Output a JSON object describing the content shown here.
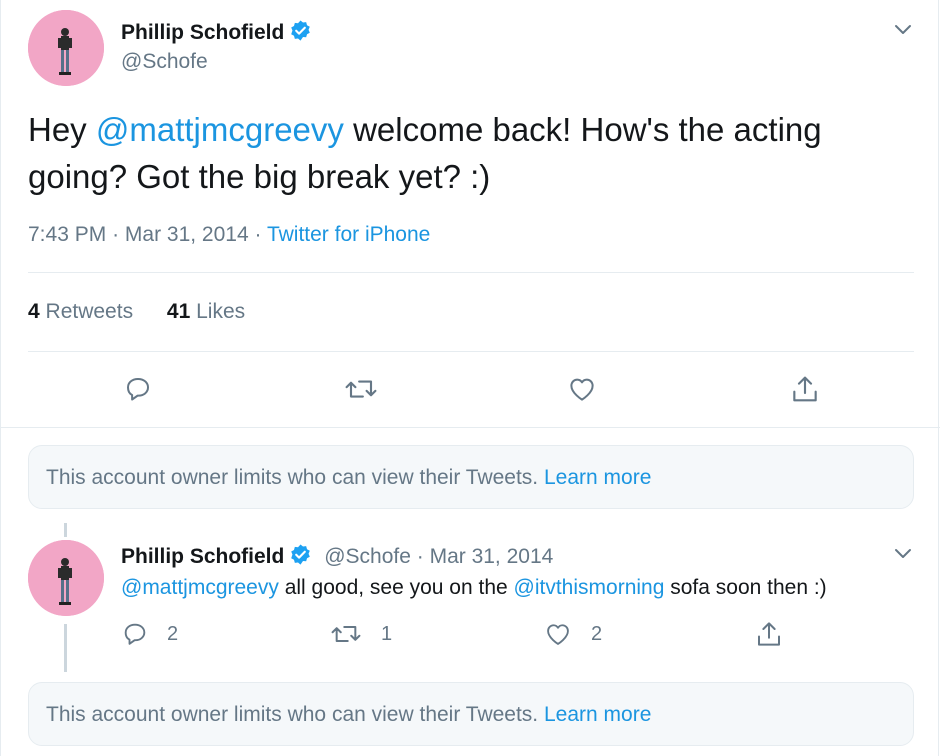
{
  "main_tweet": {
    "author_name": "Phillip Schofield",
    "handle": "@Schofe",
    "text_prefix": "Hey ",
    "mention": "@mattjmcgreevy",
    "text_suffix": " welcome back! How's the acting going? Got the big break yet? :)",
    "time": "7:43 PM",
    "date": "Mar 31, 2014",
    "source": "Twitter for iPhone",
    "retweets_count": "4",
    "retweets_label": "Retweets",
    "likes_count": "41",
    "likes_label": "Likes"
  },
  "notices": [
    {
      "text": "This account owner limits who can view their Tweets.",
      "link": "Learn more"
    },
    {
      "text": "This account owner limits who can view their Tweets.",
      "link": "Learn more"
    }
  ],
  "reply": {
    "author_name": "Phillip Schofield",
    "handle": "@Schofe",
    "date": "Mar 31, 2014",
    "mention1": "@mattjmcgreevy",
    "text_mid": " all good, see you on the ",
    "mention2": "@itvthismorning",
    "text_end": " sofa soon then :)",
    "reply_count": "2",
    "retweet_count": "1",
    "like_count": "2"
  },
  "icons": {
    "verified": "verified-badge-icon",
    "reply": "reply-icon",
    "retweet": "retweet-icon",
    "like": "heart-icon",
    "share": "share-icon",
    "more": "chevron-down-icon"
  },
  "colors": {
    "link": "#1b95e0",
    "verified": "#1da1f2",
    "muted": "#657786",
    "avatar_bg": "#f2a6c6"
  }
}
